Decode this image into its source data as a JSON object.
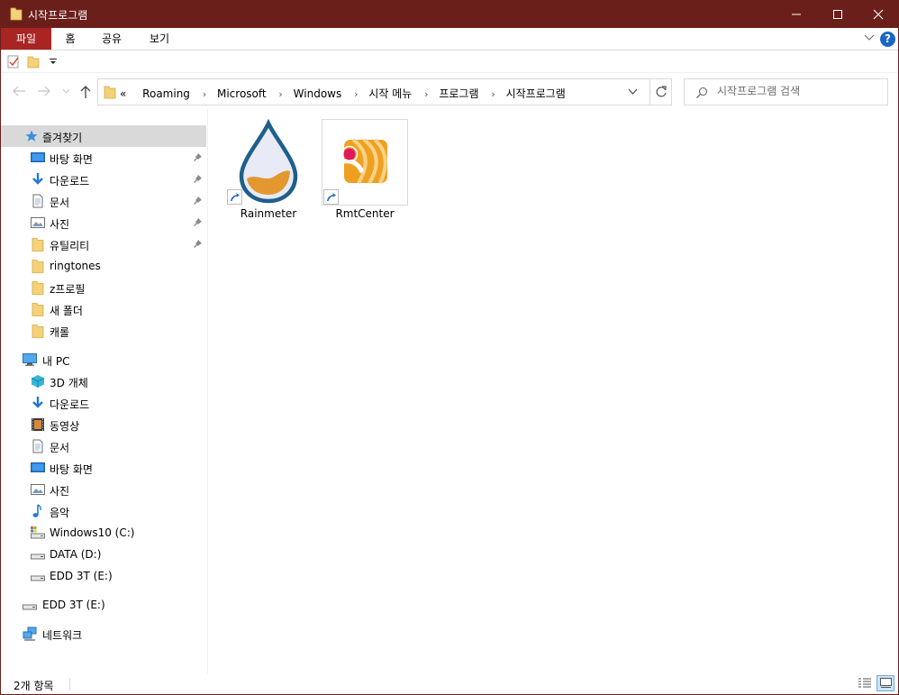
{
  "window": {
    "title": "시작프로그램",
    "accent_color": "#6b1f1a"
  },
  "ribbon": {
    "tabs": [
      {
        "label": "파일",
        "active": true
      },
      {
        "label": "홈"
      },
      {
        "label": "공유"
      },
      {
        "label": "보기"
      }
    ],
    "help_label": "?"
  },
  "address": {
    "overflow": "«",
    "crumbs": [
      "Roaming",
      "Microsoft",
      "Windows",
      "시작 메뉴",
      "프로그램",
      "시작프로그램"
    ]
  },
  "search": {
    "placeholder": "시작프로그램 검색"
  },
  "sidebar": {
    "quick_access": {
      "label": "즐겨찾기",
      "items": [
        {
          "label": "바탕 화면",
          "icon": "desktop-icon",
          "pinned": true
        },
        {
          "label": "다운로드",
          "icon": "download-icon",
          "pinned": true
        },
        {
          "label": "문서",
          "icon": "document-icon",
          "pinned": true
        },
        {
          "label": "사진",
          "icon": "pictures-icon",
          "pinned": true
        },
        {
          "label": "유틸리티",
          "icon": "folder-icon",
          "pinned": true
        },
        {
          "label": "ringtones",
          "icon": "folder-icon",
          "pinned": false
        },
        {
          "label": "z프로필",
          "icon": "folder-icon",
          "pinned": false
        },
        {
          "label": "새 폴더",
          "icon": "folder-icon",
          "pinned": false
        },
        {
          "label": "캐롤",
          "icon": "folder-icon",
          "pinned": false
        }
      ]
    },
    "this_pc": {
      "label": "내 PC",
      "items": [
        {
          "label": "3D 개체",
          "icon": "3d-objects-icon"
        },
        {
          "label": "다운로드",
          "icon": "download-icon"
        },
        {
          "label": "동영상",
          "icon": "videos-icon"
        },
        {
          "label": "문서",
          "icon": "document-icon"
        },
        {
          "label": "바탕 화면",
          "icon": "desktop-icon"
        },
        {
          "label": "사진",
          "icon": "pictures-icon"
        },
        {
          "label": "음악",
          "icon": "music-icon"
        },
        {
          "label": "Windows10 (C:)",
          "icon": "system-drive-icon"
        },
        {
          "label": "DATA (D:)",
          "icon": "drive-icon"
        },
        {
          "label": "EDD 3T (E:)",
          "icon": "drive-icon"
        }
      ]
    },
    "external": {
      "label": "EDD 3T (E:)",
      "icon": "drive-icon"
    },
    "network": {
      "label": "네트워크",
      "icon": "network-icon"
    }
  },
  "files": [
    {
      "name": "Rainmeter",
      "icon": "rainmeter-icon",
      "shortcut": true
    },
    {
      "name": "RmtCenter",
      "icon": "rmtcenter-icon",
      "shortcut": true
    }
  ],
  "status": {
    "item_count": "2개 항목"
  }
}
